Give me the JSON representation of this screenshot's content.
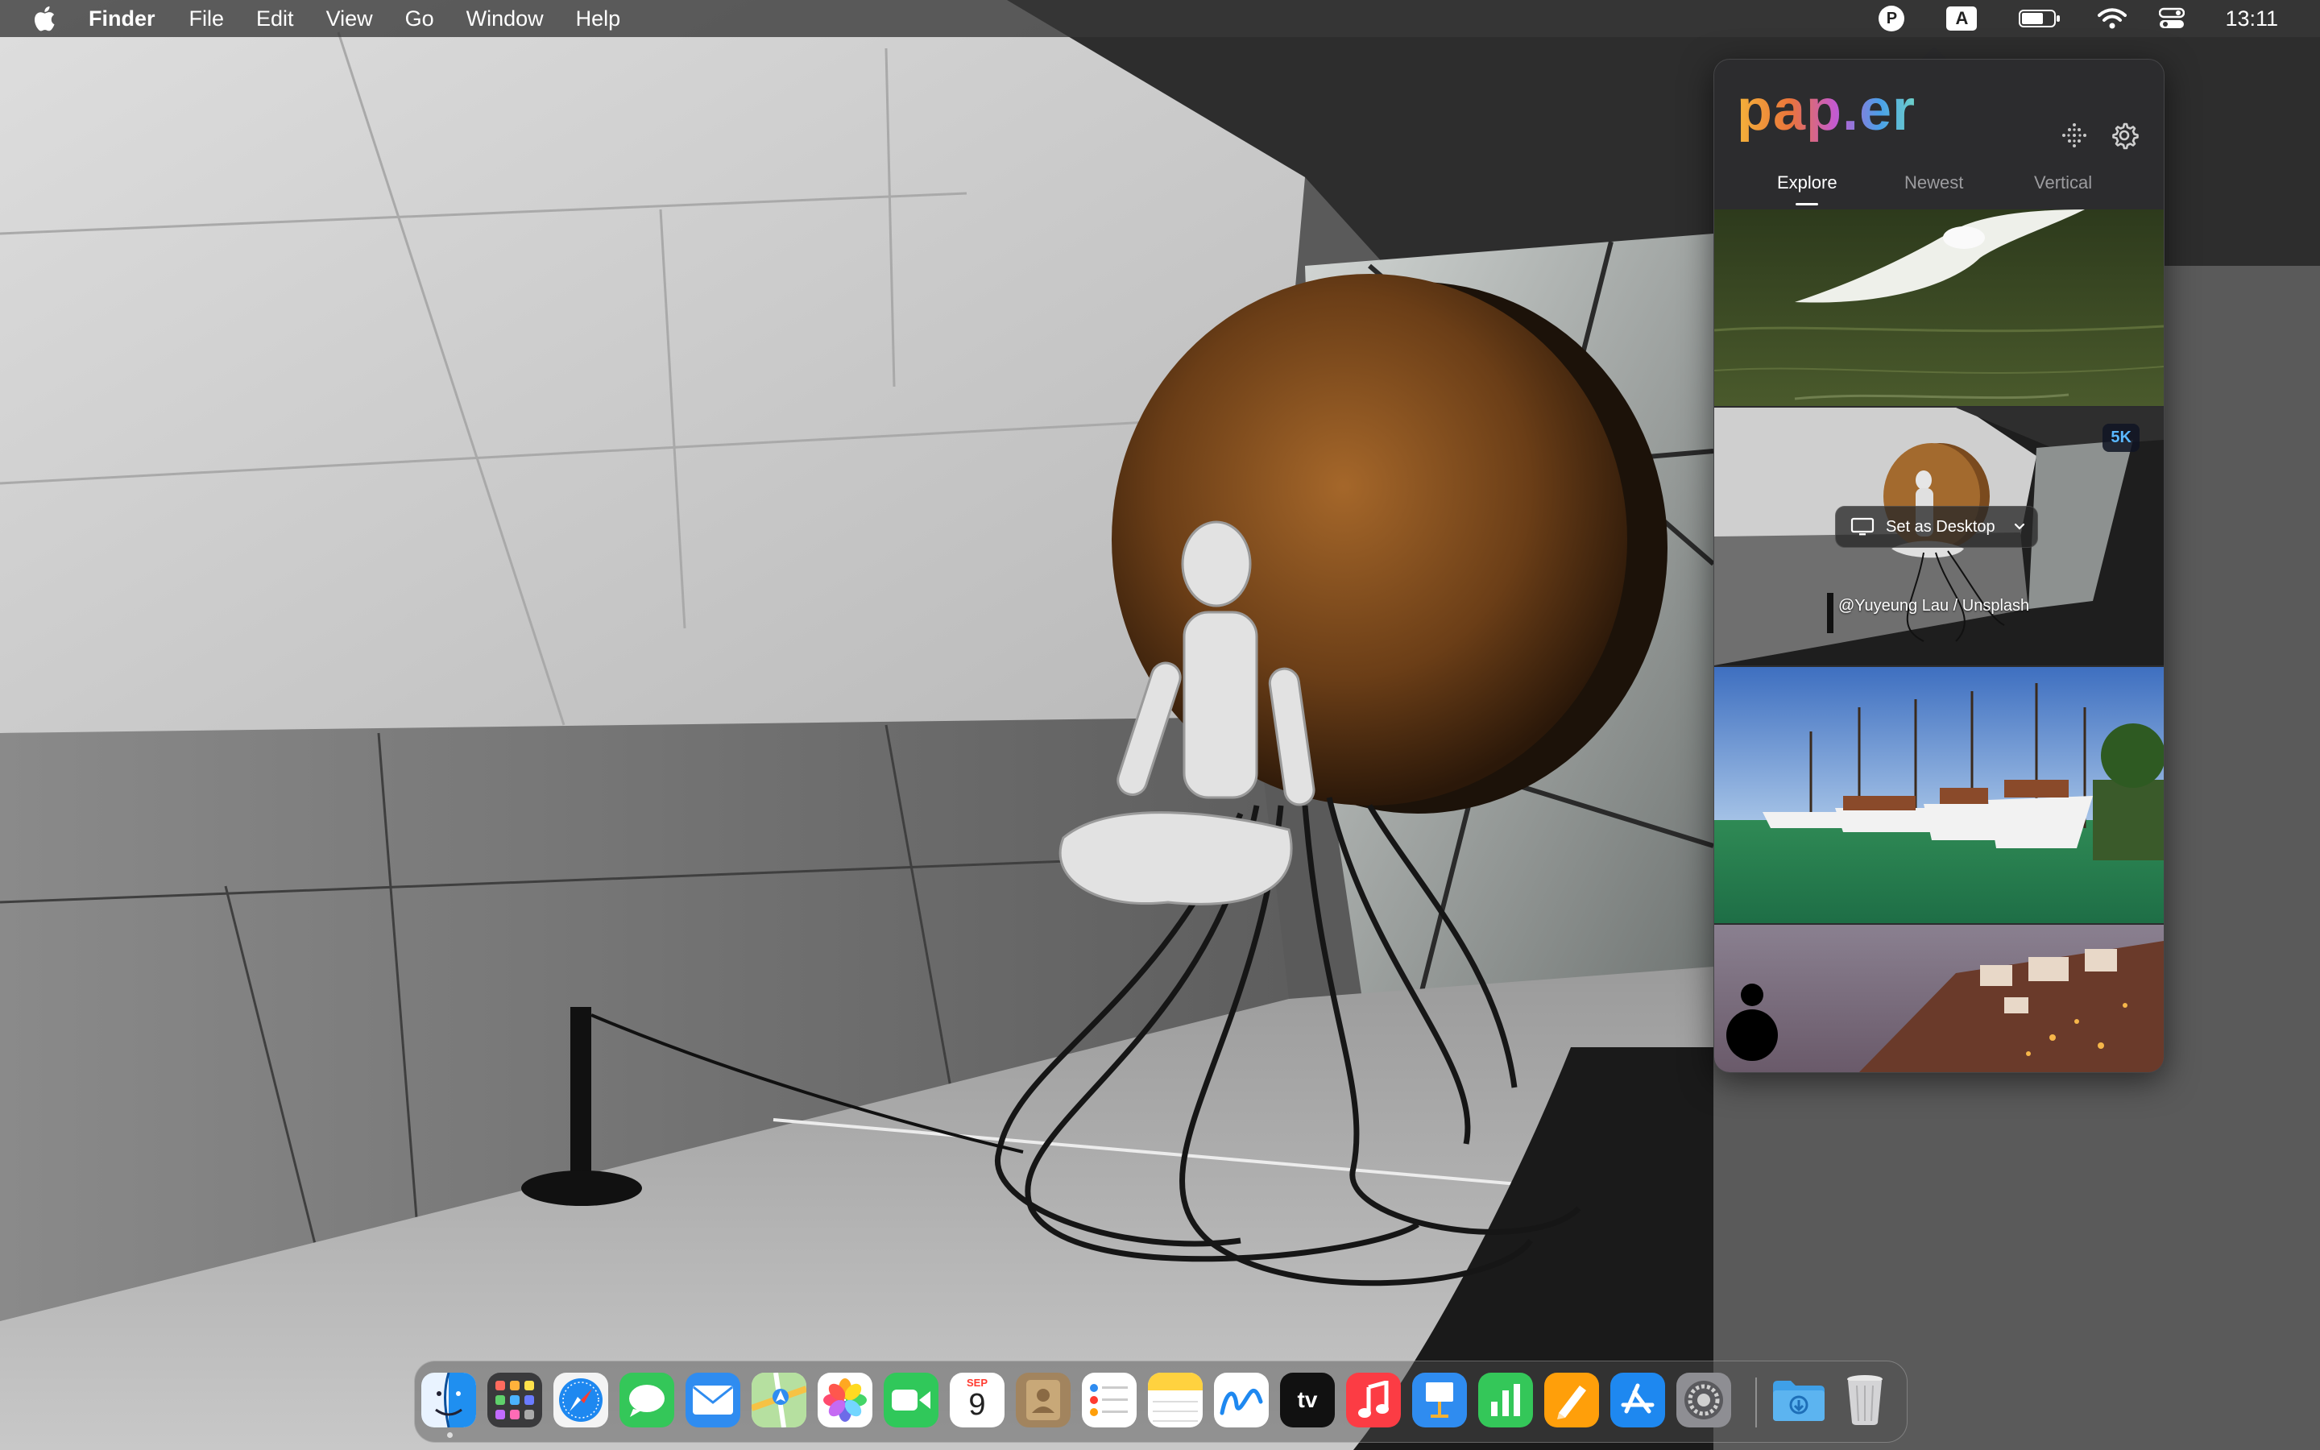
{
  "menubar": {
    "app_name": "Finder",
    "menus": [
      "File",
      "Edit",
      "View",
      "Go",
      "Window",
      "Help"
    ],
    "status_icons": [
      "pap.er-icon",
      "input-source-icon",
      "battery-icon",
      "wifi-icon",
      "control-center-icon"
    ],
    "input_source_label": "A",
    "paper_icon_label": "P",
    "clock": "13:11"
  },
  "paper_panel": {
    "logo": "pap.er",
    "tabs": [
      {
        "label": "Explore",
        "active": true
      },
      {
        "label": "Newest",
        "active": false
      },
      {
        "label": "Vertical",
        "active": false
      }
    ],
    "wallpapers": [
      {
        "subject": "egret-over-water"
      },
      {
        "subject": "robot-sculpture",
        "badge": "5K",
        "action_label": "Set as Desktop",
        "credit": "@Yuyeung Lau / Unsplash"
      },
      {
        "subject": "harbor-sailboats"
      },
      {
        "subject": "coastal-town"
      }
    ]
  },
  "dock": {
    "apps": [
      "Finder",
      "Launchpad",
      "Safari",
      "Messages",
      "Mail",
      "Maps",
      "Photos",
      "FaceTime",
      "Calendar",
      "Contacts",
      "Reminders",
      "Notes",
      "Freeform",
      "TV",
      "Music",
      "Keynote",
      "Numbers",
      "Pages",
      "App Store",
      "System Settings"
    ],
    "calendar_month": "SEP",
    "calendar_day": "9",
    "tv_label": "tv",
    "extras": [
      "Downloads",
      "Trash"
    ]
  }
}
